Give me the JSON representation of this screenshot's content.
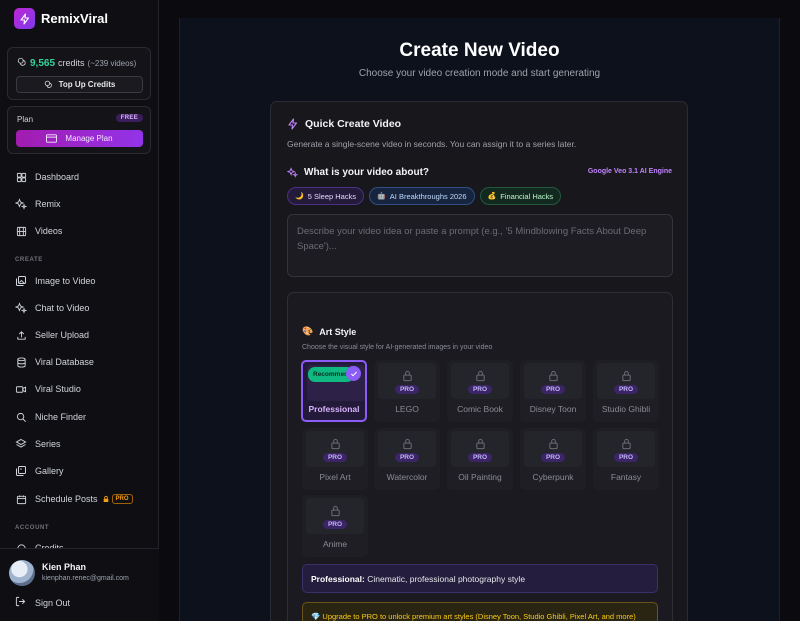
{
  "brand": {
    "name": "RemixViral"
  },
  "credits": {
    "amount": "9,565",
    "label": "credits",
    "estimate": "(~239 videos)",
    "topup_label": "Top Up Credits"
  },
  "plan": {
    "label": "Plan",
    "badge": "FREE",
    "manage_label": "Manage Plan"
  },
  "nav": {
    "main": [
      {
        "label": "Dashboard",
        "icon": "grid-icon"
      },
      {
        "label": "Remix",
        "icon": "sparkles-icon"
      },
      {
        "label": "Videos",
        "icon": "film-icon"
      }
    ],
    "create_heading": "CREATE",
    "create": [
      {
        "label": "Image to Video",
        "icon": "images-icon"
      },
      {
        "label": "Chat to Video",
        "icon": "sparkles-icon"
      },
      {
        "label": "Seller Upload",
        "icon": "upload-icon"
      },
      {
        "label": "Viral Database",
        "icon": "database-icon"
      },
      {
        "label": "Viral Studio",
        "icon": "video-icon"
      },
      {
        "label": "Niche Finder",
        "icon": "search-icon"
      },
      {
        "label": "Series",
        "icon": "layers-icon"
      },
      {
        "label": "Gallery",
        "icon": "gallery-icon"
      },
      {
        "label": "Schedule Posts",
        "icon": "calendar-icon",
        "badge": "PRO"
      }
    ],
    "account_heading": "ACCOUNT",
    "account": [
      {
        "label": "Credits",
        "icon": "coin-icon"
      }
    ]
  },
  "user": {
    "name": "Kien Phan",
    "email": "kienphan.renec@gmail.com",
    "signout_label": "Sign Out"
  },
  "page": {
    "title": "Create New Video",
    "subtitle": "Choose your video creation mode and start generating"
  },
  "quick_create": {
    "title": "Quick Create Video",
    "description": "Generate a single-scene video in seconds. You can assign it to a series later.",
    "about_label": "What is your video about?",
    "engine": "Google Veo 3.1 AI Engine",
    "chips": [
      {
        "emoji": "🌙",
        "label": "5 Sleep Hacks"
      },
      {
        "emoji": "🤖",
        "label": "AI Breakthroughs 2026"
      },
      {
        "emoji": "💰",
        "label": "Financial Hacks"
      }
    ],
    "prompt_placeholder": "Describe your video idea or paste a prompt (e.g., '5 Mindblowing Facts About Deep Space')..."
  },
  "art_style": {
    "emoji": "🎨",
    "title": "Art Style",
    "description": "Choose the visual style for AI-generated images in your video",
    "recommended_label": "Recommended",
    "pro_label": "PRO",
    "styles": [
      {
        "label": "Professional",
        "selected": true,
        "locked": false
      },
      {
        "label": "LEGO",
        "locked": true
      },
      {
        "label": "Comic Book",
        "locked": true
      },
      {
        "label": "Disney Toon",
        "locked": true
      },
      {
        "label": "Studio Ghibli",
        "locked": true
      },
      {
        "label": "Pixel Art",
        "locked": true
      },
      {
        "label": "Watercolor",
        "locked": true
      },
      {
        "label": "Oil Painting",
        "locked": true
      },
      {
        "label": "Cyberpunk",
        "locked": true
      },
      {
        "label": "Fantasy",
        "locked": true
      },
      {
        "label": "Anime",
        "locked": true
      }
    ],
    "selected_note": {
      "name": "Professional:",
      "text": "Cinematic, professional photography style"
    },
    "upgrade_note": "💎 Upgrade to PRO to unlock premium art styles (Disney Toon, Studio Ghibli, Pixel Art, and more)"
  },
  "colors": {
    "accent": "#8b5cf6",
    "credits_green": "#34d399",
    "brand_gradient": "#c026d3"
  }
}
